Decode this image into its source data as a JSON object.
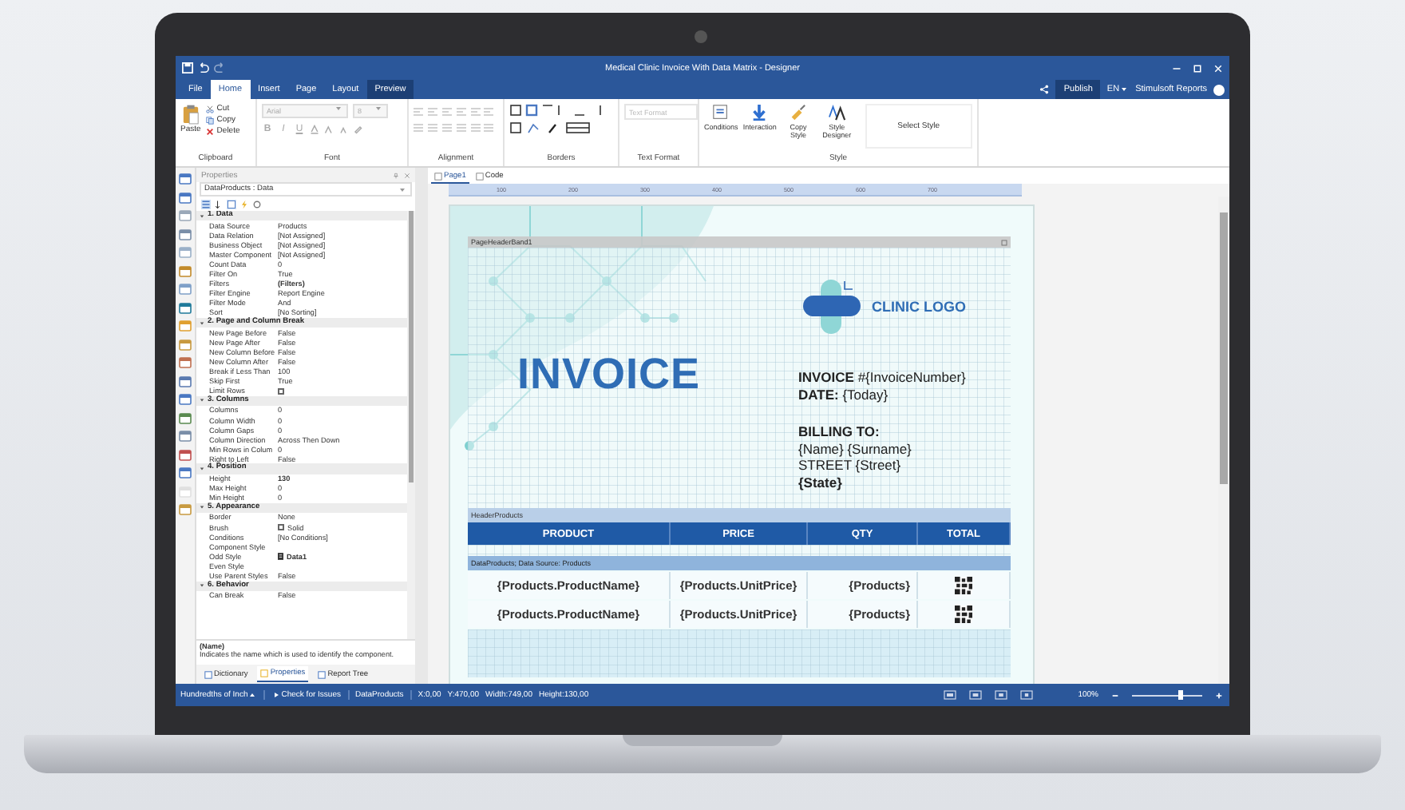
{
  "title_bar": {
    "title": "Medical Clinic Invoice With Data Matrix - Designer"
  },
  "menu_tabs": [
    {
      "label": "File",
      "selected": false,
      "highlighted": false
    },
    {
      "label": "Home",
      "selected": true,
      "highlighted": false
    },
    {
      "label": "Insert",
      "selected": false,
      "highlighted": false
    },
    {
      "label": "Page",
      "selected": false,
      "highlighted": false
    },
    {
      "label": "Layout",
      "selected": false,
      "highlighted": false
    },
    {
      "label": "Preview",
      "selected": false,
      "highlighted": true
    }
  ],
  "account": {
    "publish": "Publish",
    "language": "EN",
    "product": "Stimulsoft Reports"
  },
  "ribbon": {
    "clipboard": {
      "label": "Clipboard",
      "paste": "Paste",
      "items": [
        "Cut",
        "Copy",
        "Delete"
      ]
    },
    "font": {
      "label": "Font",
      "family": "Arial",
      "size": "8",
      "format_buttons": [
        "B",
        "I",
        "U"
      ]
    },
    "alignment": {
      "label": "Alignment"
    },
    "borders": {
      "label": "Borders"
    },
    "text_format": {
      "label": "Text Format",
      "placeholder": "Text Format"
    },
    "style": {
      "label": "Style",
      "buttons": [
        "Conditions",
        "Interaction",
        "Copy Style",
        "Style Designer"
      ],
      "gallery": "Select Style"
    }
  },
  "properties": {
    "title": "Properties",
    "object": "DataProducts : Data",
    "categories": [
      {
        "title": "1. Data",
        "expanded": true,
        "rows": [
          {
            "name": "Data Source",
            "kind": "text",
            "value": "Products"
          },
          {
            "name": "Data Relation",
            "kind": "text",
            "value": "[Not Assigned]"
          },
          {
            "name": "Business Object",
            "kind": "text",
            "value": "[Not Assigned]"
          },
          {
            "name": "Master Component",
            "kind": "text",
            "value": "[Not Assigned]"
          },
          {
            "name": "Count Data",
            "kind": "text",
            "value": "0"
          },
          {
            "name": "Filter On",
            "kind": "text",
            "value": "True"
          },
          {
            "name": "Filters",
            "kind": "text",
            "value": "(Filters)",
            "bold": true
          },
          {
            "name": "Filter Engine",
            "kind": "text",
            "value": "Report Engine"
          },
          {
            "name": "Filter Mode",
            "kind": "text",
            "value": "And"
          },
          {
            "name": "Sort",
            "kind": "text",
            "value": "[No Sorting]"
          }
        ]
      },
      {
        "title": "2. Page and Column Break",
        "expanded": true,
        "rows": [
          {
            "name": "New Page Before",
            "kind": "text",
            "value": "False"
          },
          {
            "name": "New Page After",
            "kind": "text",
            "value": "False"
          },
          {
            "name": "New Column Before",
            "kind": "text",
            "value": "False"
          },
          {
            "name": "New Column After",
            "kind": "text",
            "value": "False"
          },
          {
            "name": "Break if Less Than",
            "kind": "text",
            "value": "100"
          },
          {
            "name": "Skip First",
            "kind": "text",
            "value": "True"
          },
          {
            "name": "Limit Rows",
            "kind": "check",
            "checked": false
          }
        ]
      },
      {
        "title": "3. Columns",
        "expanded": true,
        "rows": [
          {
            "name": "Columns",
            "kind": "text",
            "value": "0"
          },
          {
            "name": "Column Width",
            "kind": "text",
            "value": "0"
          },
          {
            "name": "Column Gaps",
            "kind": "text",
            "value": "0"
          },
          {
            "name": "Column Direction",
            "kind": "text",
            "value": "Across Then Down"
          },
          {
            "name": "Min Rows in Colum",
            "kind": "text",
            "value": "0"
          },
          {
            "name": "Right to Left",
            "kind": "text",
            "value": "False"
          }
        ]
      },
      {
        "title": "4. Position",
        "expanded": true,
        "rows": [
          {
            "name": "Height",
            "kind": "text",
            "value": "130",
            "bold": true
          },
          {
            "name": "Max Height",
            "kind": "text",
            "value": "0"
          },
          {
            "name": "Min Height",
            "kind": "text",
            "value": "0"
          }
        ]
      },
      {
        "title": "5. Appearance",
        "expanded": true,
        "rows": [
          {
            "name": "Border",
            "kind": "text",
            "value": "None"
          },
          {
            "name": "Brush",
            "kind": "brush",
            "value": "Solid"
          },
          {
            "name": "Conditions",
            "kind": "text",
            "value": "[No Conditions]"
          },
          {
            "name": "Component Style",
            "kind": "text"
          },
          {
            "name": "Odd Style",
            "kind": "style",
            "value": "Data1",
            "bold": true
          },
          {
            "name": "Even Style",
            "kind": "text"
          },
          {
            "name": "Use Parent Styles",
            "kind": "text",
            "value": "False"
          }
        ]
      },
      {
        "title": "6. Behavior",
        "expanded": true,
        "rows": [
          {
            "name": "Can Break",
            "kind": "text",
            "value": "False"
          }
        ]
      }
    ],
    "description": {
      "name": "(Name)",
      "text": "Indicates the name which is used to identify the component."
    },
    "tabs": [
      {
        "label": "Dictionary",
        "selected": false
      },
      {
        "label": "Properties",
        "selected": true
      },
      {
        "label": "Report Tree",
        "selected": false
      }
    ]
  },
  "designer": {
    "tabs": [
      {
        "label": "Page1",
        "selected": true
      },
      {
        "label": "Code",
        "selected": false
      }
    ],
    "ruler": [
      "100",
      "200",
      "300",
      "400",
      "500",
      "600",
      "700"
    ],
    "header_band": "PageHeaderBand1",
    "logo": "CLINIC LOGO",
    "title": "INVOICE",
    "info_lines": [
      {
        "text": "**INVOICE** #{InvoiceNumber}"
      },
      {
        "text": "**DATE:** {Today}"
      }
    ],
    "billing": {
      "heading": "BILLING TO:",
      "lines": [
        {
          "text": "{Name} {Surname}",
          "bold": false
        },
        {
          "text": "STREET {Street}",
          "bold": false
        },
        {
          "text": "{State}",
          "bold": true
        }
      ]
    },
    "table_band": "HeaderProducts",
    "columns": [
      "PRODUCT",
      "PRICE",
      "QTY",
      "TOTAL"
    ],
    "data_band": "DataProducts; Data Source: Products",
    "rows": [
      [
        "{Products.ProductName}",
        "{Products.UnitPrice}",
        "{Products}"
      ],
      [
        "{Products.ProductName}",
        "{Products.UnitPrice}",
        "{Products}"
      ]
    ]
  },
  "status_bar": {
    "units": "Hundredths of Inch",
    "check": "Check for Issues",
    "component": "DataProducts",
    "x": "X:0,00",
    "y": "Y:470,00",
    "width": "Width:749,00",
    "height": "Height:130,00",
    "zoom": "100%",
    "zoom_slider": {
      "level": 0.7
    }
  }
}
